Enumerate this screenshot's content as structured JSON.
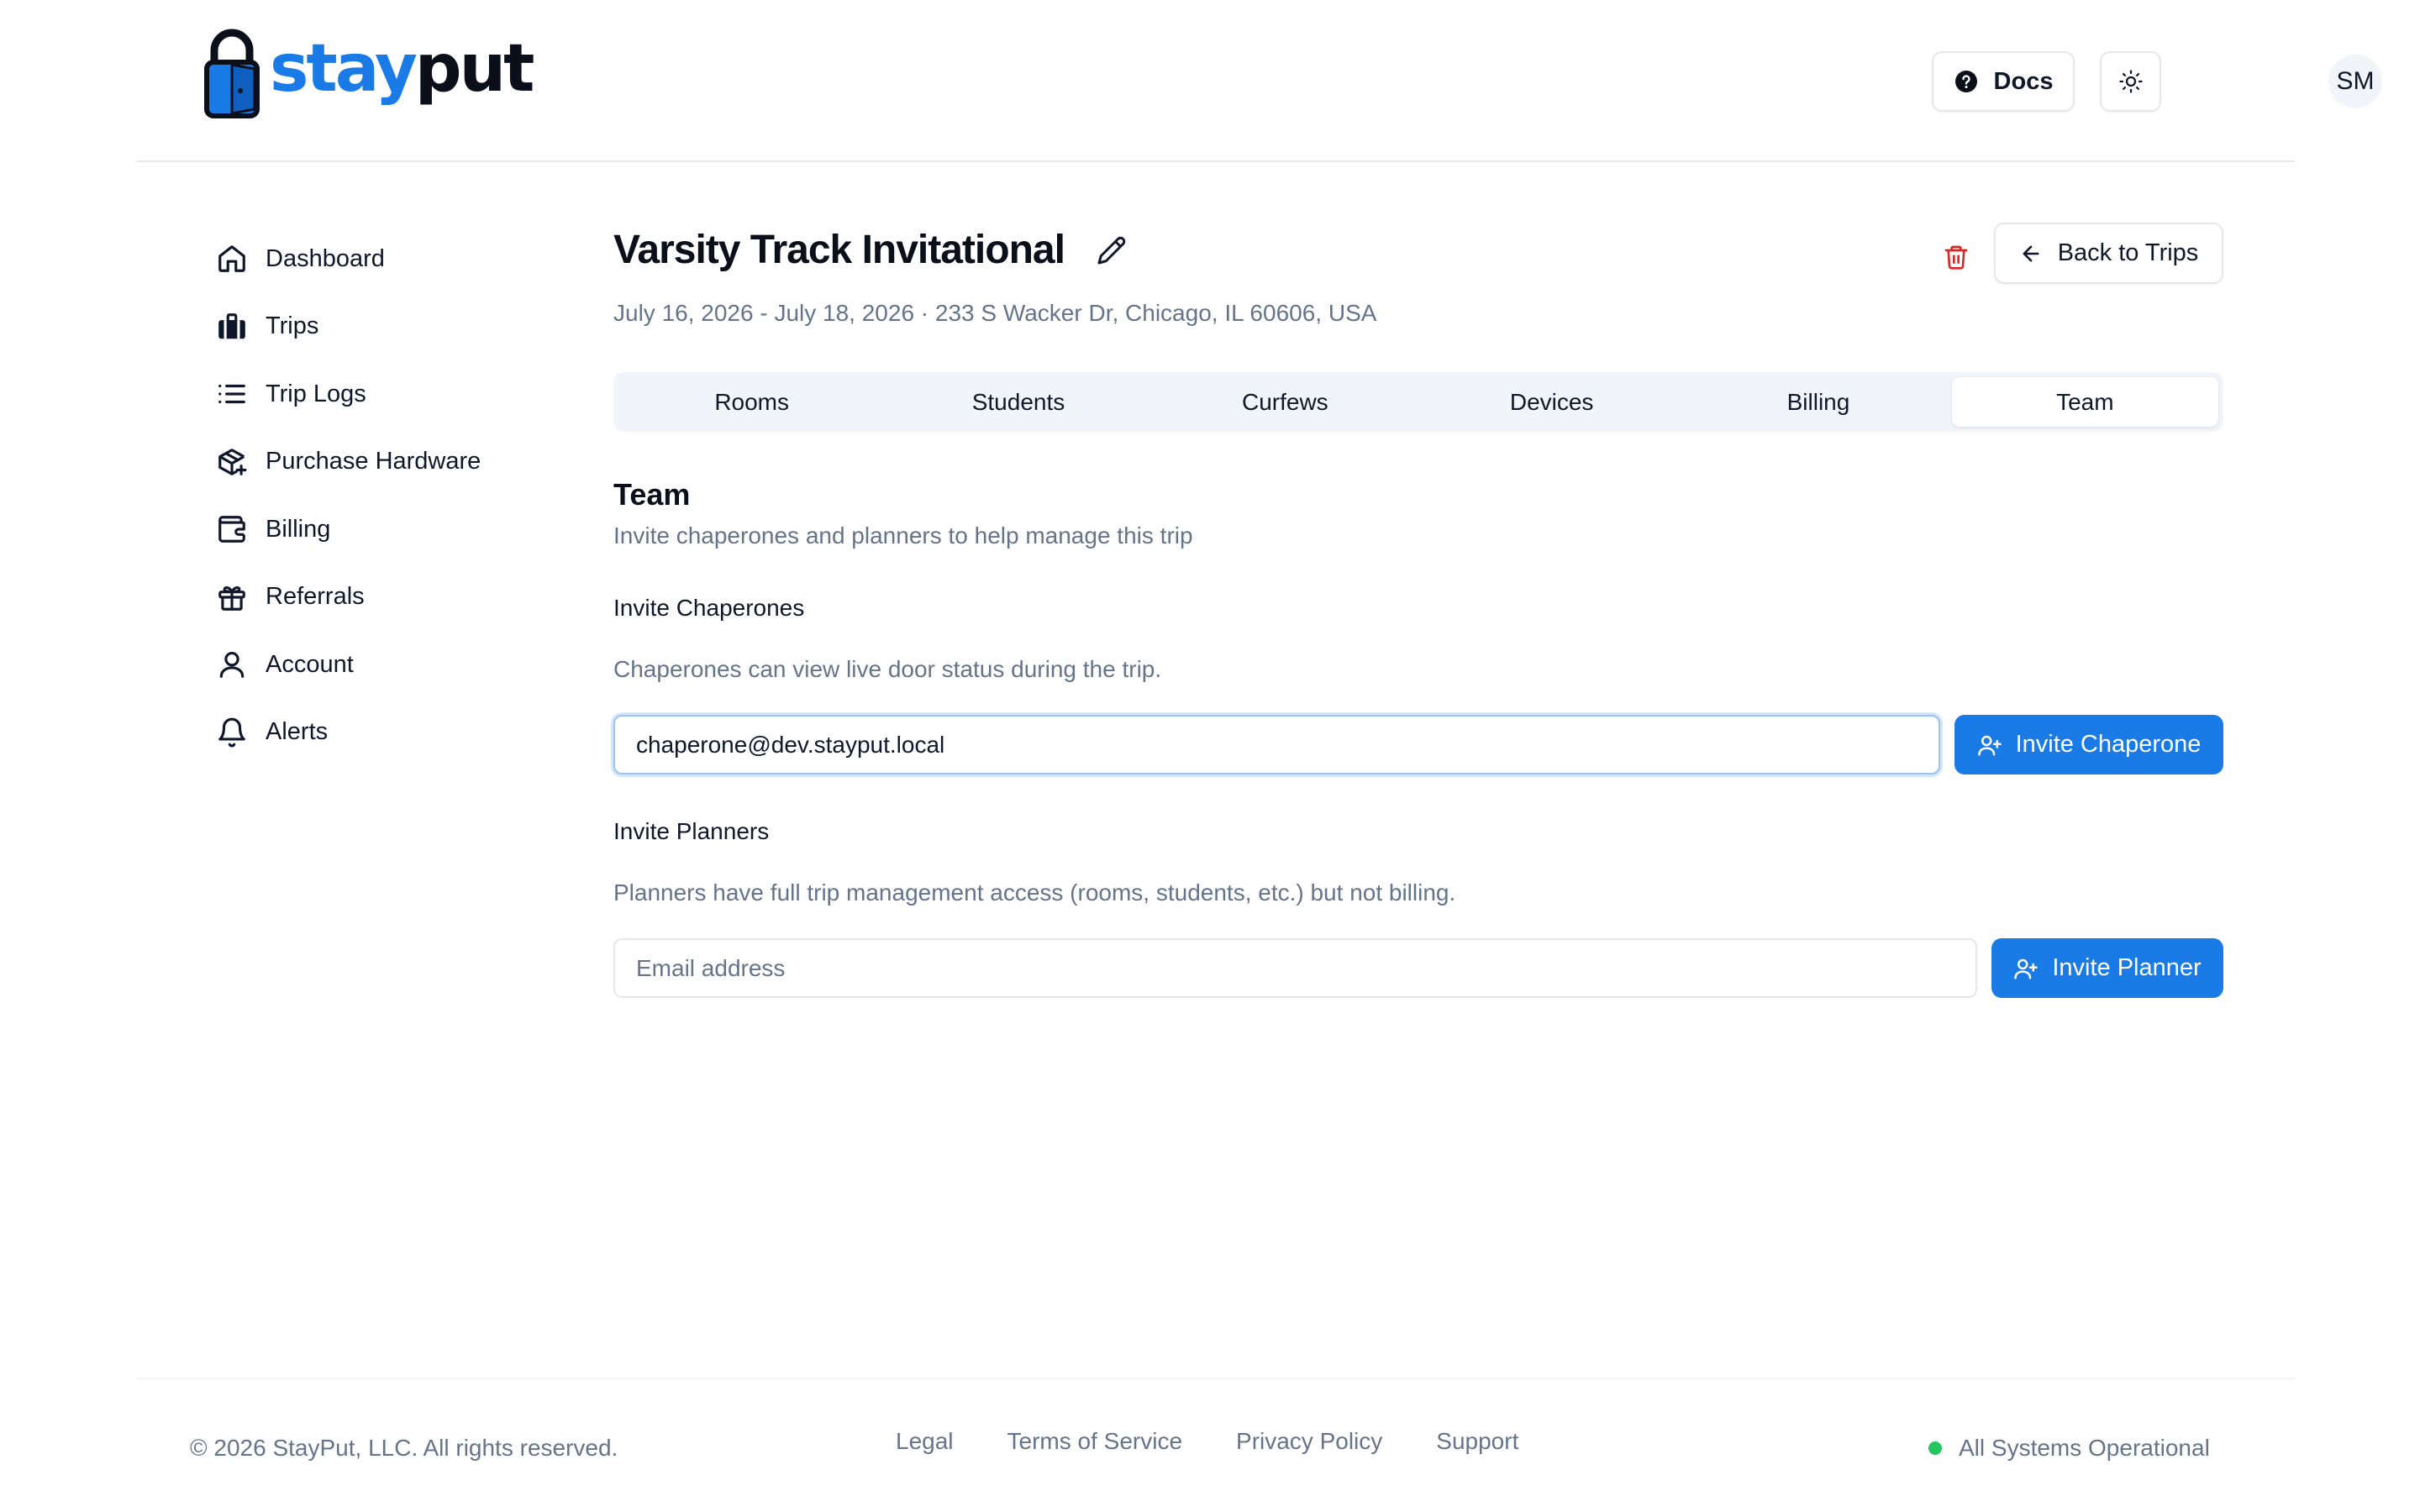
{
  "header": {
    "logo": {
      "part1": "stay",
      "part2": "put"
    },
    "docs_label": "Docs",
    "avatar_initials": "SM"
  },
  "sidebar": {
    "items": [
      {
        "label": "Dashboard",
        "icon": "home-icon"
      },
      {
        "label": "Trips",
        "icon": "luggage-icon"
      },
      {
        "label": "Trip Logs",
        "icon": "list-icon"
      },
      {
        "label": "Purchase Hardware",
        "icon": "package-plus-icon"
      },
      {
        "label": "Billing",
        "icon": "wallet-icon"
      },
      {
        "label": "Referrals",
        "icon": "gift-icon"
      },
      {
        "label": "Account",
        "icon": "user-icon"
      },
      {
        "label": "Alerts",
        "icon": "bell-icon"
      }
    ]
  },
  "trip": {
    "title": "Varsity Track Invitational",
    "subtitle": "July 16, 2026 - July 18, 2026 · 233 S Wacker Dr, Chicago, IL 60606, USA",
    "back_label": "Back to Trips"
  },
  "tabs": [
    {
      "label": "Rooms"
    },
    {
      "label": "Students"
    },
    {
      "label": "Curfews"
    },
    {
      "label": "Devices"
    },
    {
      "label": "Billing"
    },
    {
      "label": "Team",
      "active": true
    }
  ],
  "team": {
    "title": "Team",
    "description": "Invite chaperones and planners to help manage this trip",
    "chaperones": {
      "label": "Invite Chaperones",
      "help": "Chaperones can view live door status during the trip.",
      "value": "chaperone@dev.stayput.local",
      "button": "Invite Chaperone"
    },
    "planners": {
      "label": "Invite Planners",
      "help": "Planners have full trip management access (rooms, students, etc.) but not billing.",
      "placeholder": "Email address",
      "value": "",
      "button": "Invite Planner"
    }
  },
  "footer": {
    "copyright": "© 2026 StayPut, LLC. All rights reserved.",
    "links": [
      "Legal",
      "Terms of Service",
      "Privacy Policy",
      "Support"
    ],
    "status": "All Systems Operational"
  },
  "colors": {
    "brand": "#1a7ae6",
    "danger": "#dc2626",
    "status_ok": "#22c55e"
  }
}
